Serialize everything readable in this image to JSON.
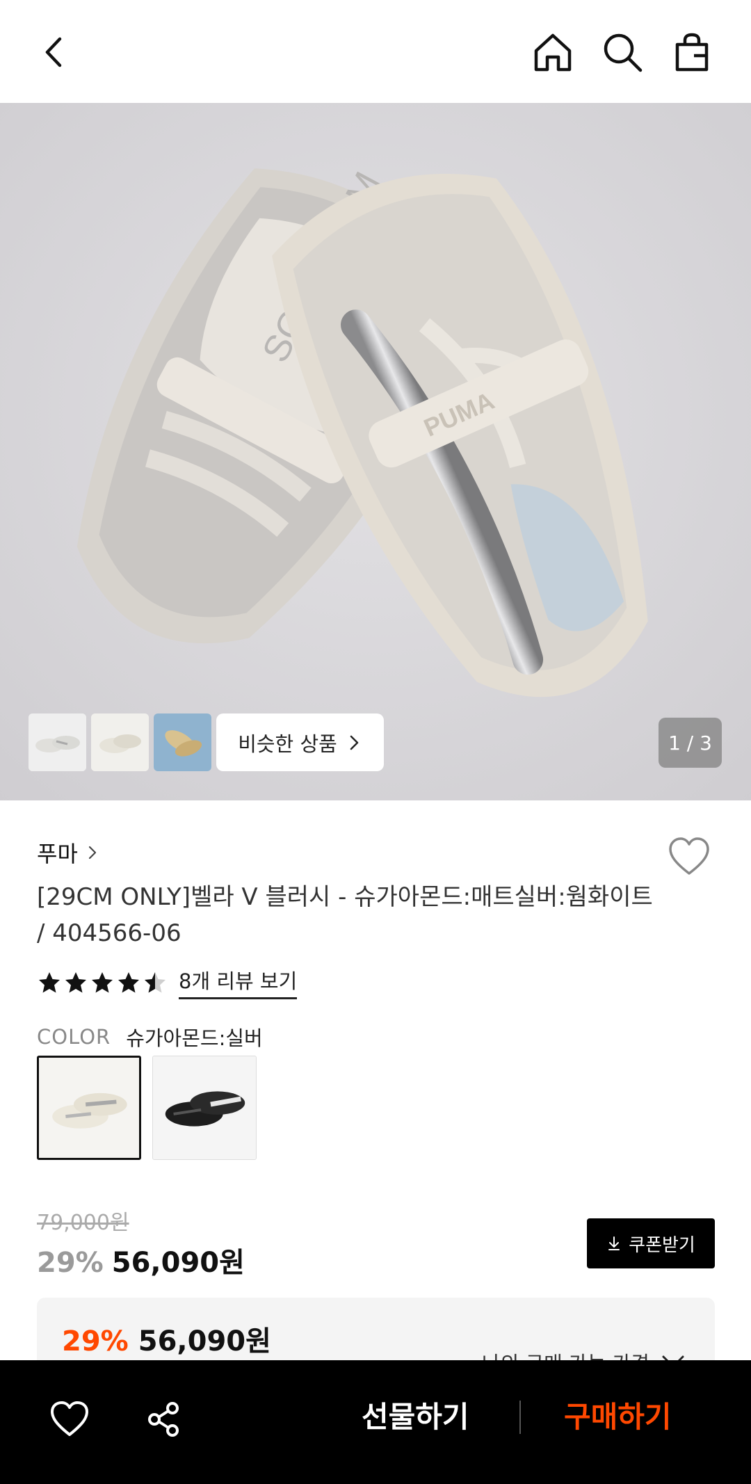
{
  "header": {
    "back_icon": "chevron-left-icon",
    "home_icon": "home-icon",
    "search_icon": "search-icon",
    "bag_icon": "shopping-bag-icon"
  },
  "gallery": {
    "similar_label": "비슷한 상품",
    "pager": "1 / 3",
    "thumbnail_count": 3
  },
  "product": {
    "brand": "푸마",
    "title": "[29CM ONLY]벨라 V 블러시 - 슈가아몬드:매트실버:웜화이트 / 404566-06",
    "rating": 4.5,
    "review_link": "8개 리뷰 보기",
    "color_label": "COLOR",
    "color_value": "슈가아몬드:실버",
    "swatches": [
      "sugar-almond",
      "black"
    ]
  },
  "price": {
    "original": "79,000원",
    "discount": "29%",
    "sale": "56,090원",
    "coupon_label": "쿠폰받기"
  },
  "my_price": {
    "discount": "29%",
    "amount": "56,090원",
    "toggle_label": "나의 구매 가능 가격"
  },
  "bottom_bar": {
    "gift_label": "선물하기",
    "buy_label": "구매하기"
  },
  "colors": {
    "accent": "#ff4800",
    "bar": "#000000"
  }
}
